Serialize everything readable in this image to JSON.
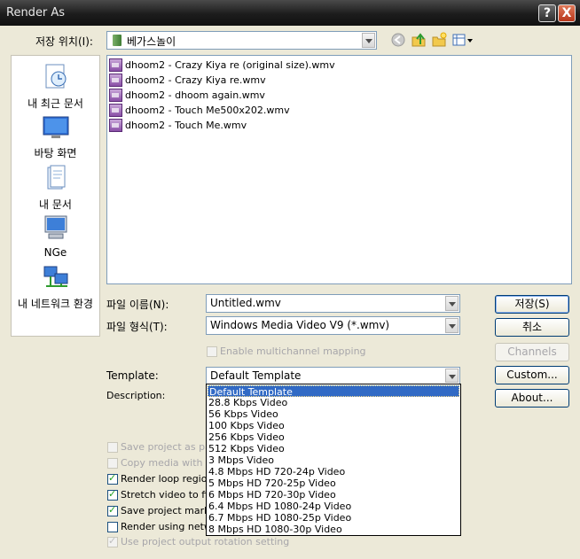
{
  "window": {
    "title": "Render As",
    "help_label": "?",
    "close_label": "X"
  },
  "save_in": {
    "label": "저장 위치(I):",
    "value": "베가스놀이"
  },
  "places": [
    {
      "label": "내 최근 문서",
      "icon": "recent-docs-icon"
    },
    {
      "label": "바탕 화면",
      "icon": "desktop-icon"
    },
    {
      "label": "내 문서",
      "icon": "my-documents-icon"
    },
    {
      "label": "NGe",
      "icon": "my-computer-icon"
    },
    {
      "label": "내 네트워크 환경",
      "icon": "network-icon"
    }
  ],
  "files": [
    "dhoom2 - Crazy Kiya re (original size).wmv",
    "dhoom2 - Crazy Kiya re.wmv",
    "dhoom2 - dhoom again.wmv",
    "dhoom2 - Touch Me500x202.wmv",
    "dhoom2 - Touch Me.wmv"
  ],
  "filename": {
    "label": "파일 이름(N):",
    "value": "Untitled.wmv"
  },
  "filetype": {
    "label": "파일 형식(T):",
    "value": "Windows Media Video V9 (*.wmv)"
  },
  "multichannel": {
    "label": "Enable multichannel mapping",
    "checked": false
  },
  "template": {
    "label": "Template:",
    "value": "Default Template",
    "options": [
      "Default Template",
      "28.8 Kbps Video",
      "56 Kbps Video",
      "100 Kbps Video",
      "256 Kbps Video",
      "512 Kbps Video",
      "3 Mbps Video",
      "4.8 Mbps HD 720-24p Video",
      "5 Mbps HD 720-25p Video",
      "6 Mbps HD 720-30p Video",
      "6.4 Mbps HD 1080-24p Video",
      "6.7 Mbps HD 1080-25p Video",
      "8 Mbps HD 1080-30p Video"
    ]
  },
  "description_label": "Description:",
  "options": [
    {
      "label": "Save project as pat",
      "checked": false,
      "disabled": true
    },
    {
      "label": "Copy media with pr",
      "checked": false,
      "disabled": true
    },
    {
      "label": "Render loop region",
      "checked": true,
      "disabled": false
    },
    {
      "label": "Stretch video to fill",
      "checked": true,
      "disabled": false
    },
    {
      "label": "Save project marke",
      "checked": true,
      "disabled": false
    },
    {
      "label": "Render using netwo",
      "checked": false,
      "disabled": false
    },
    {
      "label": "Use project output rotation setting",
      "checked": true,
      "disabled": true
    }
  ],
  "buttons": {
    "save": "저장(S)",
    "cancel": "취소",
    "channels": "Channels",
    "custom": "Custom...",
    "about": "About..."
  },
  "colors": {
    "selection": "#316ac5",
    "dialog_bg": "#ECE9D8",
    "titlebar": "#1c1c1c"
  }
}
